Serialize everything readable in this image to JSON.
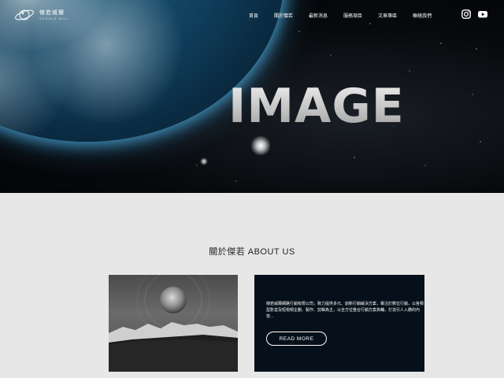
{
  "brand": {
    "name_cn": "傑若威爾",
    "name_en": "GERALD WILL"
  },
  "nav": {
    "items": [
      {
        "label": "首頁"
      },
      {
        "label": "關於傑若"
      },
      {
        "label": "最新消息"
      },
      {
        "label": "服務項目"
      },
      {
        "label": "文章專區"
      },
      {
        "label": "聯絡我們"
      }
    ],
    "social": [
      {
        "icon": "instagram-icon"
      },
      {
        "icon": "youtube-icon"
      }
    ]
  },
  "hero": {
    "word": "IMAGE",
    "accent_color": "#5ab4e6"
  },
  "about": {
    "title": "關於傑若 ABOUT US",
    "description": "傑若威爾網路行銷有限公司，致力提供多元、創新行銷解決方案，專注於數位行銷，以各類型影音及短視頻企劃、製作、剪輯為主，以全方位整合行銷方案為輔，打造引人入勝的內容...",
    "button_label": "READ MORE",
    "card_color": "#06101a"
  }
}
